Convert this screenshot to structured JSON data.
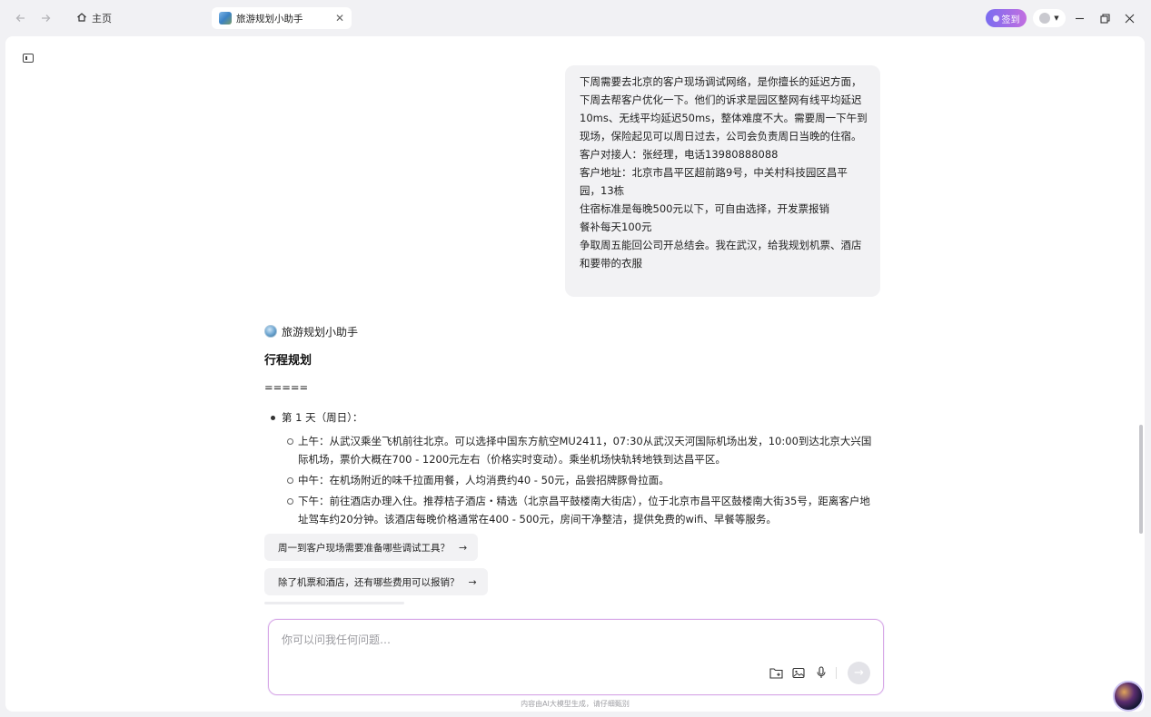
{
  "titlebar": {
    "home_label": "主页",
    "active_tab_title": "旅游规划小助手",
    "signin_label": "签到"
  },
  "user_message": {
    "lines": [
      "下周需要去北京的客户现场调试网络，是你擅长的延迟方面，下周去帮客户优化一下。他们的诉求是园区整网有线平均延迟10ms、无线平均延迟50ms，整体难度不大。需要周一下午到现场，保险起见可以周日过去，公司会负责周日当晚的住宿。",
      "客户对接人：张经理，电话13980888088",
      "客户地址：北京市昌平区超前路9号，中关村科技园区昌平园，13栋",
      "住宿标准是每晚500元以下，可自由选择，开发票报销",
      "餐补每天100元",
      "争取周五能回公司开总结会。我在武汉，给我规划机票、酒店和要带的衣服"
    ]
  },
  "assistant": {
    "name": "旅游规划小助手",
    "title": "行程规划",
    "rule": "=====",
    "day_label": "第 1 天（周日）：",
    "items": [
      "上午：从武汉乘坐飞机前往北京。可以选择中国东方航空MU2411，07:30从武汉天河国际机场出发，10:00到达北京大兴国际机场，票价大概在700 - 1200元左右（价格实时变动）。乘坐机场快轨转地铁到达昌平区。",
      "中午：在机场附近的味千拉面用餐，人均消费约40 - 50元，品尝招牌豚骨拉面。",
      "下午：前往酒店办理入住。推荐桔子酒店・精选（北京昌平鼓楼南大街店），位于北京市昌平区鼓楼南大街35号，距离客户地址驾车约20分钟。该酒店每晚价格通常在400 - 500元，房间干净整洁，提供免费的wifi、早餐等服务。"
    ]
  },
  "suggestions": [
    "周一到客户现场需要准备哪些调试工具？",
    "除了机票和酒店，还有哪些费用可以报销？"
  ],
  "input": {
    "placeholder": "你可以问我任何问题…",
    "value": ""
  },
  "disclaimer": "内容由AI大模型生成，请仔细甄别",
  "colors": {
    "accent_gradient_start": "#7a6cf0",
    "accent_gradient_end": "#c26ee0",
    "input_border": "#d9a8e6"
  }
}
